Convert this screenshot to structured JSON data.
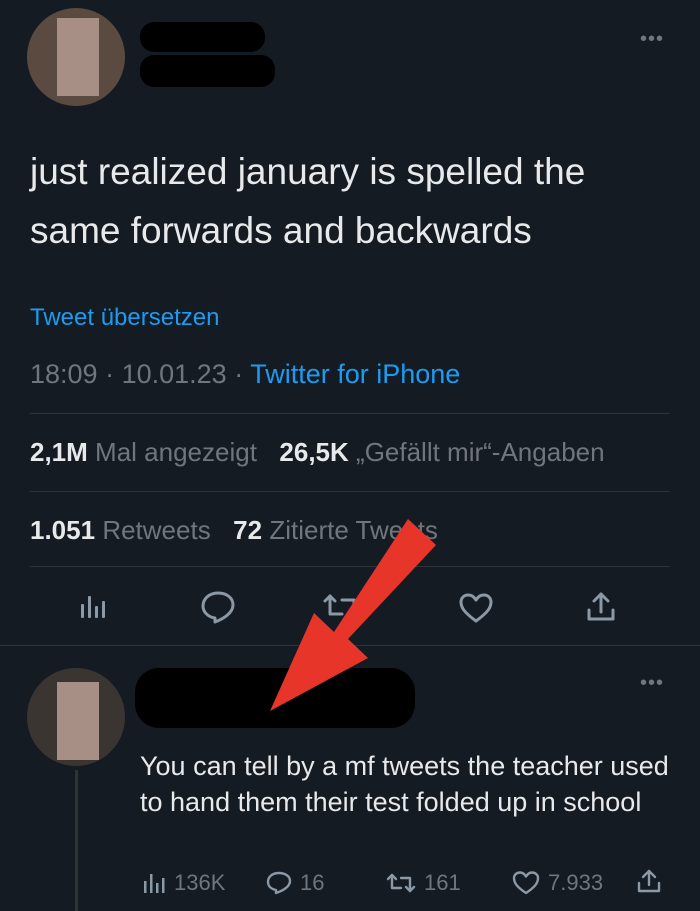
{
  "tweet": {
    "text": "just realized january is spelled the same forwards and backwards",
    "translate_label": "Tweet übersetzen",
    "time": "18:09",
    "separator": " · ",
    "date": "10.01.23",
    "source": "Twitter for iPhone",
    "views_count": "2,1M",
    "views_label": "Mal angezeigt",
    "likes_count": "26,5K",
    "likes_label": "„Gefällt mir“-Angaben",
    "retweets_count": "1.051",
    "retweets_label": "Retweets",
    "quotes_count": "72",
    "quotes_label": "Zitierte Tweets"
  },
  "reply": {
    "text": "You can tell by a mf tweets the teacher used to hand them their test folded up in school",
    "views": "136K",
    "replies": "16",
    "retweets": "161",
    "likes": "7.933"
  },
  "colors": {
    "background": "#151b23",
    "link": "#1d9bf0",
    "arrow": "#e8352a"
  }
}
